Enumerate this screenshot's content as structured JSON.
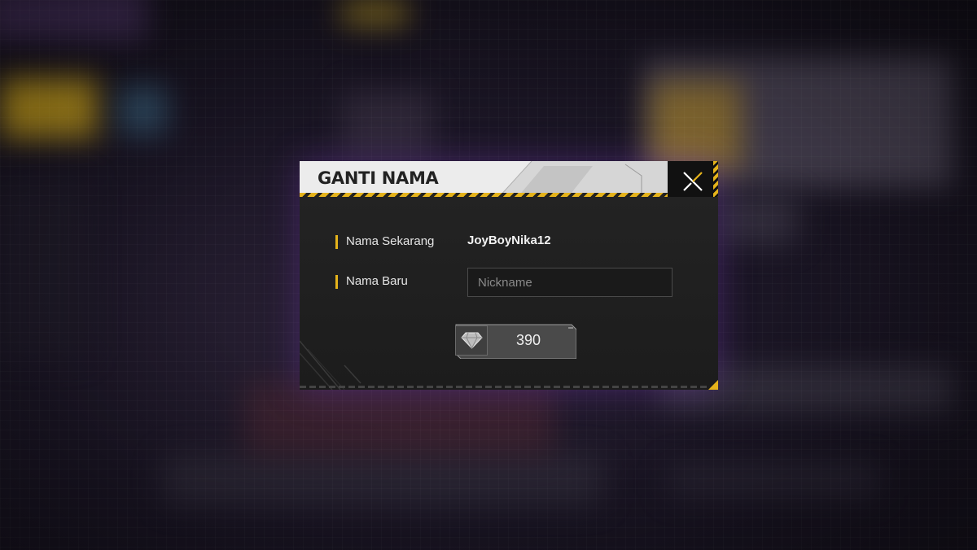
{
  "dialog": {
    "title": "GANTI NAMA",
    "close_icon": "close-x-icon"
  },
  "fields": {
    "current": {
      "label": "Nama Sekarang",
      "value": "JoyBoyNika12"
    },
    "new": {
      "label": "Nama Baru",
      "placeholder": "Nickname",
      "value": ""
    }
  },
  "purchase": {
    "currency_icon": "diamond-icon",
    "price": "390"
  },
  "colors": {
    "accent": "#e5b31b",
    "panel": "#1e1e1e",
    "header": "#ececec"
  }
}
